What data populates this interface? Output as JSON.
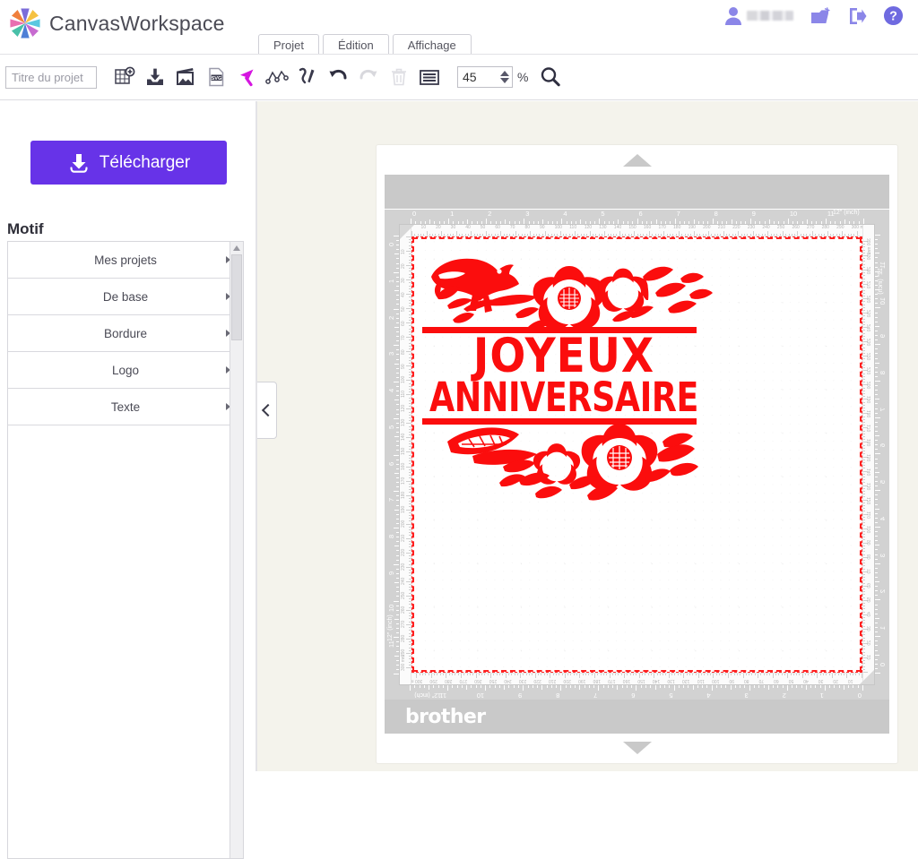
{
  "app": {
    "brand_name": "CanvasWorkspace",
    "logo_icon": "pinwheel-logo-icon",
    "logo_colors": [
      "#e86fb0",
      "#f5c242",
      "#5bc8e0",
      "#7b6cd9",
      "#f07f3c",
      "#49c0a8",
      "#c76bd0",
      "#4e7fd6"
    ]
  },
  "account": {
    "user_icon": "user-account-icon",
    "user_name_masked": "",
    "new_project_icon": "new-project-icon",
    "logout_icon": "logout-icon",
    "help_icon": "help-question-icon"
  },
  "tabs": [
    {
      "label": "Projet",
      "name": "tab-projet",
      "active": true
    },
    {
      "label": "Édition",
      "name": "tab-edition",
      "active": false
    },
    {
      "label": "Affichage",
      "name": "tab-affichage",
      "active": false
    }
  ],
  "toolbar": {
    "project_title_value": "",
    "project_title_placeholder": "Titre du projet",
    "zoom_value": "45",
    "zoom_unit": "%",
    "buttons": [
      {
        "name": "new-sheet-icon",
        "label": "Nouveau",
        "disabled": false
      },
      {
        "name": "import-file-icon",
        "label": "Importer",
        "disabled": false
      },
      {
        "name": "insert-image-icon",
        "label": "Insérer image",
        "disabled": false
      },
      {
        "name": "svg-file-icon",
        "label": "SVG",
        "disabled": false
      },
      {
        "name": "select-arrow-icon",
        "label": "Sélection",
        "disabled": false
      },
      {
        "name": "node-edit-icon",
        "label": "Modifier les points",
        "disabled": false
      },
      {
        "name": "draw-pen-icon",
        "label": "Dessiner",
        "disabled": false
      },
      {
        "name": "undo-icon",
        "label": "Annuler",
        "disabled": false
      },
      {
        "name": "redo-icon",
        "label": "Rétablir",
        "disabled": true
      },
      {
        "name": "delete-trash-icon",
        "label": "Supprimer",
        "disabled": true
      },
      {
        "name": "list-menu-icon",
        "label": "Liste",
        "disabled": false
      },
      {
        "name": "zoom-search-icon",
        "label": "Zoom",
        "disabled": false
      }
    ]
  },
  "sidebar": {
    "download_label": "Télécharger",
    "download_icon": "download-arrow-icon",
    "download_color": "#6733e8",
    "section_title": "Motif",
    "items": [
      {
        "label": "Mes projets",
        "name": "sidebar-item-mes-projets"
      },
      {
        "label": "De base",
        "name": "sidebar-item-de-base"
      },
      {
        "label": "Bordure",
        "name": "sidebar-item-bordure"
      },
      {
        "label": "Logo",
        "name": "sidebar-item-logo"
      },
      {
        "label": "Texte",
        "name": "sidebar-item-texte"
      }
    ]
  },
  "canvas": {
    "collapse_icon": "chevron-left-icon",
    "scroll_up_icon": "scroll-up-arrow-icon",
    "scroll_down_icon": "scroll-down-arrow-icon",
    "mat_brand": "brother",
    "ruler_unit_label": "12\" (inch)",
    "ruler_inch_labels": [
      "0",
      "1",
      "2",
      "3",
      "4",
      "5",
      "6",
      "7",
      "8",
      "9",
      "10",
      "11"
    ],
    "ruler_mm_labels": [
      "10",
      "20",
      "30",
      "40",
      "50",
      "60",
      "70",
      "80",
      "90",
      "100",
      "110",
      "120",
      "130",
      "140",
      "150",
      "160",
      "170",
      "180",
      "190",
      "200",
      "210",
      "220",
      "230",
      "240",
      "250",
      "260",
      "270",
      "280",
      "290",
      "300 mm"
    ],
    "cut_border_color": "#ff2020",
    "artwork": {
      "name": "joyeux-anniversaire-papercut-design",
      "fill_color": "#fb0d0d",
      "text_line_1": "JOYEUX",
      "text_line_2": "ANNIVERSAIRE",
      "motifs": [
        "bird",
        "flowers",
        "leaves",
        "split-banner"
      ]
    }
  }
}
